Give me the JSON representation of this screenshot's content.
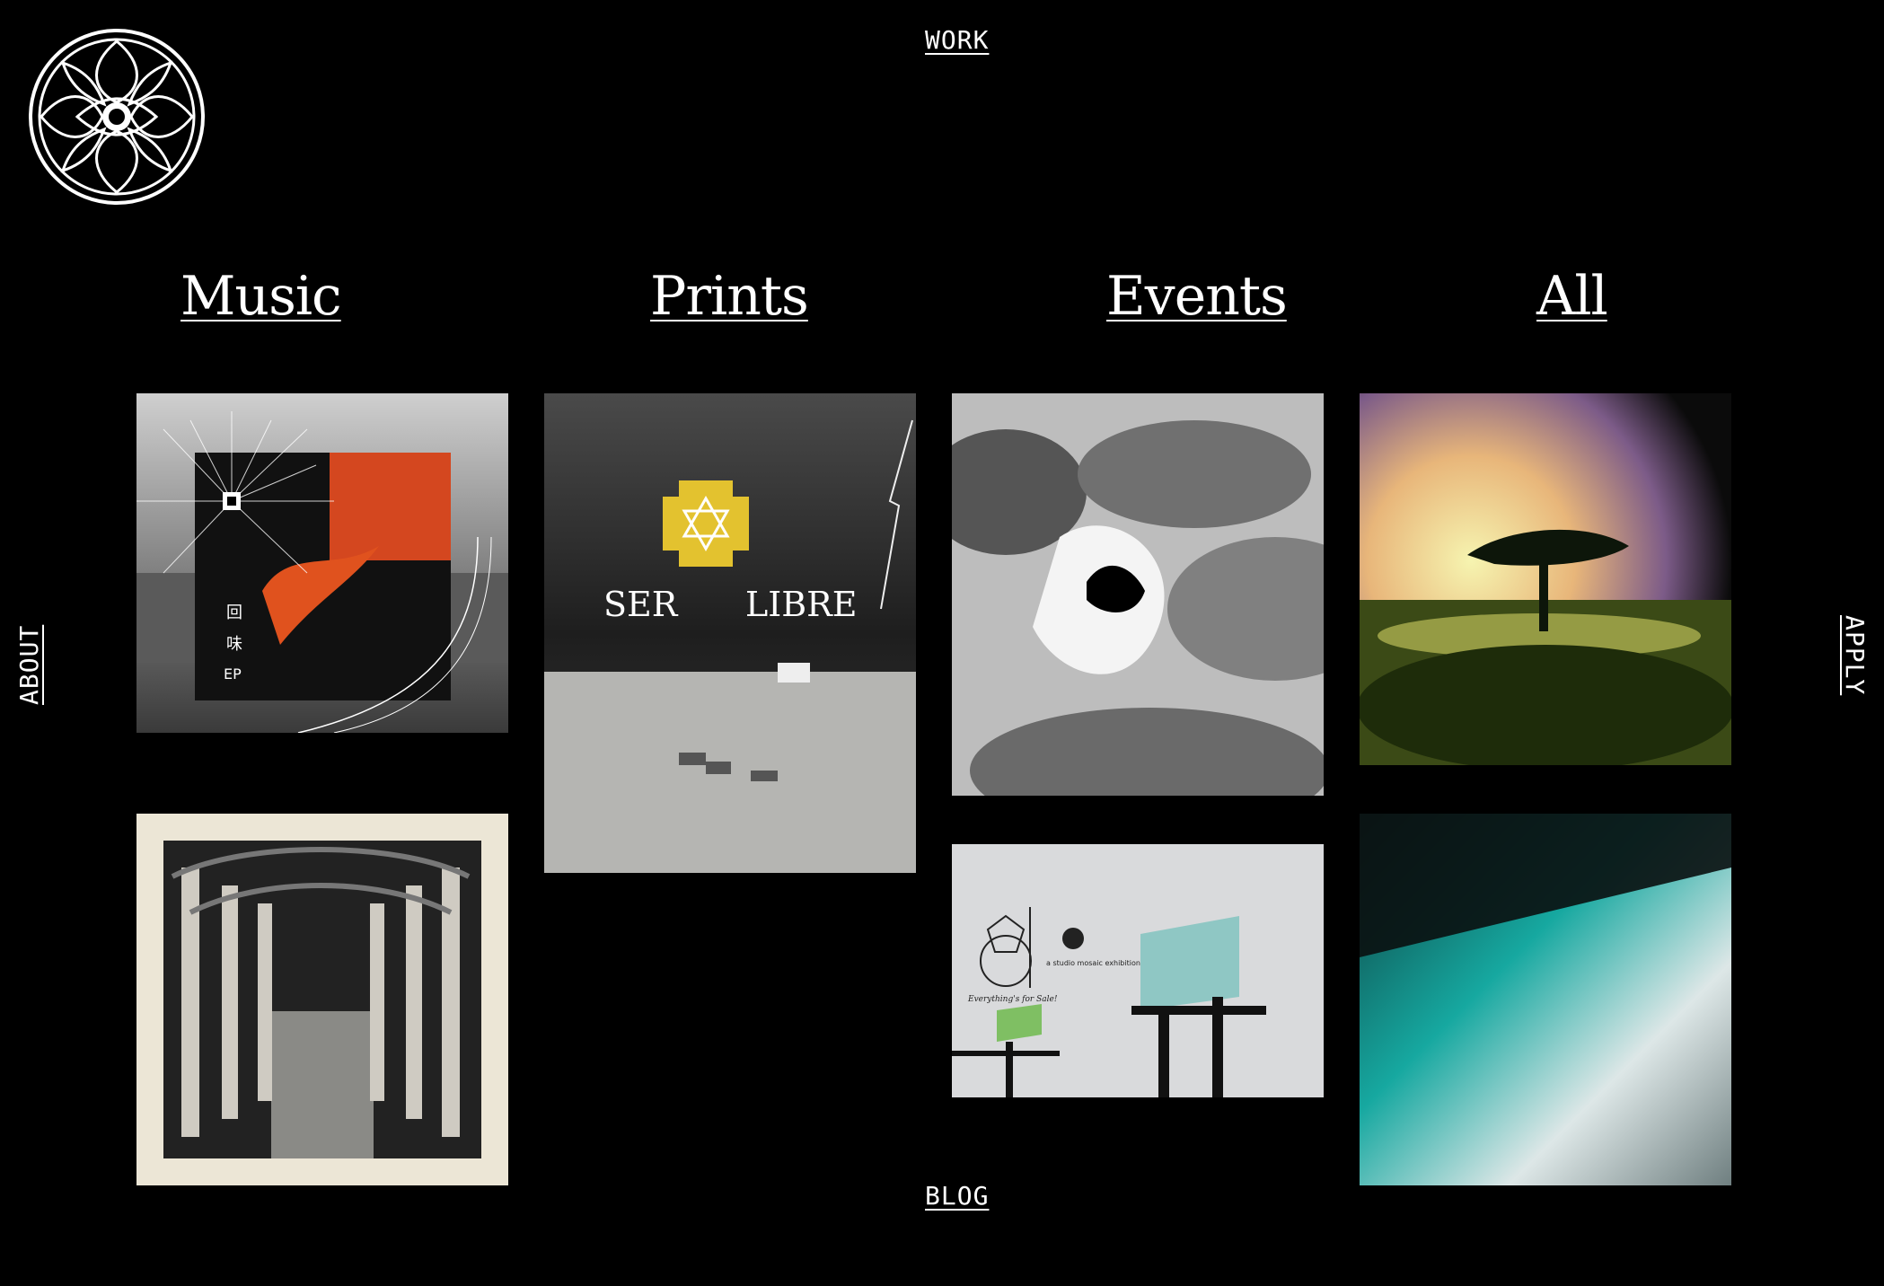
{
  "nav": {
    "work": "WORK",
    "blog": "BLOG",
    "about": "ABOUT",
    "apply": "APPLY"
  },
  "categories": {
    "music": "Music",
    "prints": "Prints",
    "events": "Events",
    "all": "All"
  },
  "tiles": {
    "music_1": {
      "cover_text": [
        "回",
        "味",
        "EP"
      ]
    },
    "print_1": {
      "cover_text": [
        "SER",
        "LIBRE"
      ]
    },
    "event_2": {
      "cover_text": [
        "Everything's for Sale!",
        "a studio mosaic exhibition"
      ]
    }
  },
  "colors": {
    "background": "#000000",
    "text": "#ffffff"
  }
}
